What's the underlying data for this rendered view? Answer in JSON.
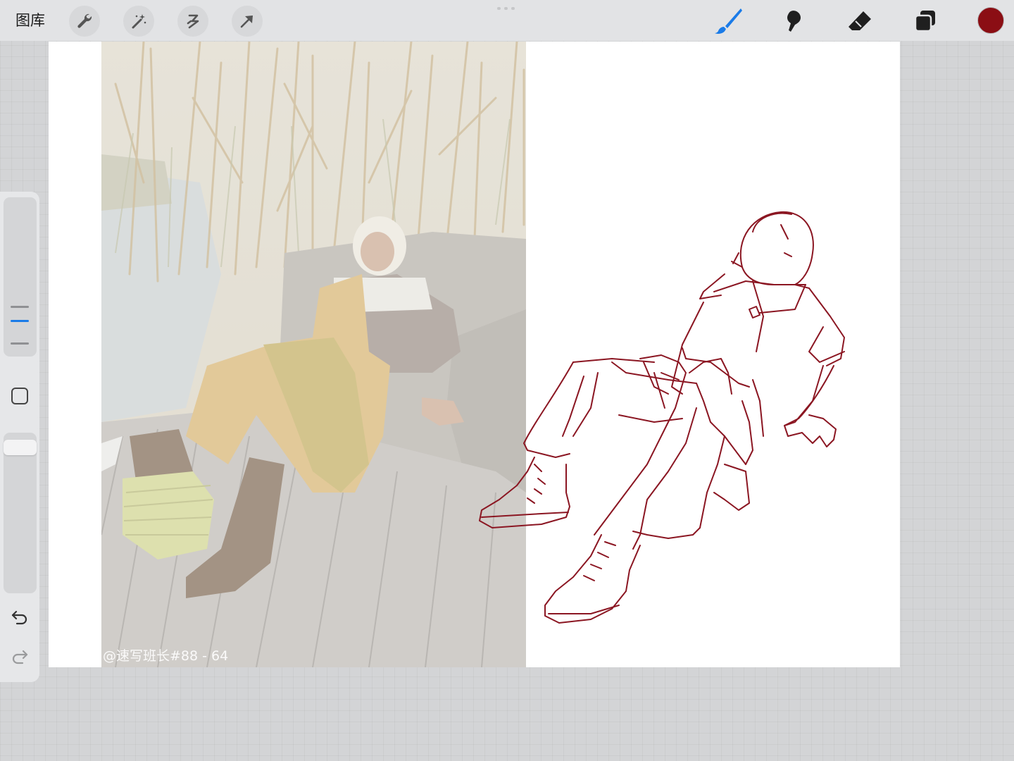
{
  "toolbar": {
    "gallery_label": "图库",
    "left_tools": [
      "wrench-icon",
      "magic-wand-icon",
      "selection-icon",
      "transform-arrow-icon"
    ],
    "right_tools": [
      "brush-icon",
      "smudge-icon",
      "eraser-icon",
      "layers-icon"
    ],
    "active_tool": "brush",
    "active_color": "#8b0e14",
    "accent": "#1a7be8"
  },
  "canvas": {
    "reference_photo": {
      "watermark": "@速写班长#88 - 64"
    },
    "sketch_color": "#8b1622"
  },
  "sidebar": {
    "brush_size_level": 0.4,
    "opacity_level": 0.95,
    "undo_icon": "undo-icon",
    "redo_icon": "redo-icon",
    "modify_icon": "square-icon"
  }
}
